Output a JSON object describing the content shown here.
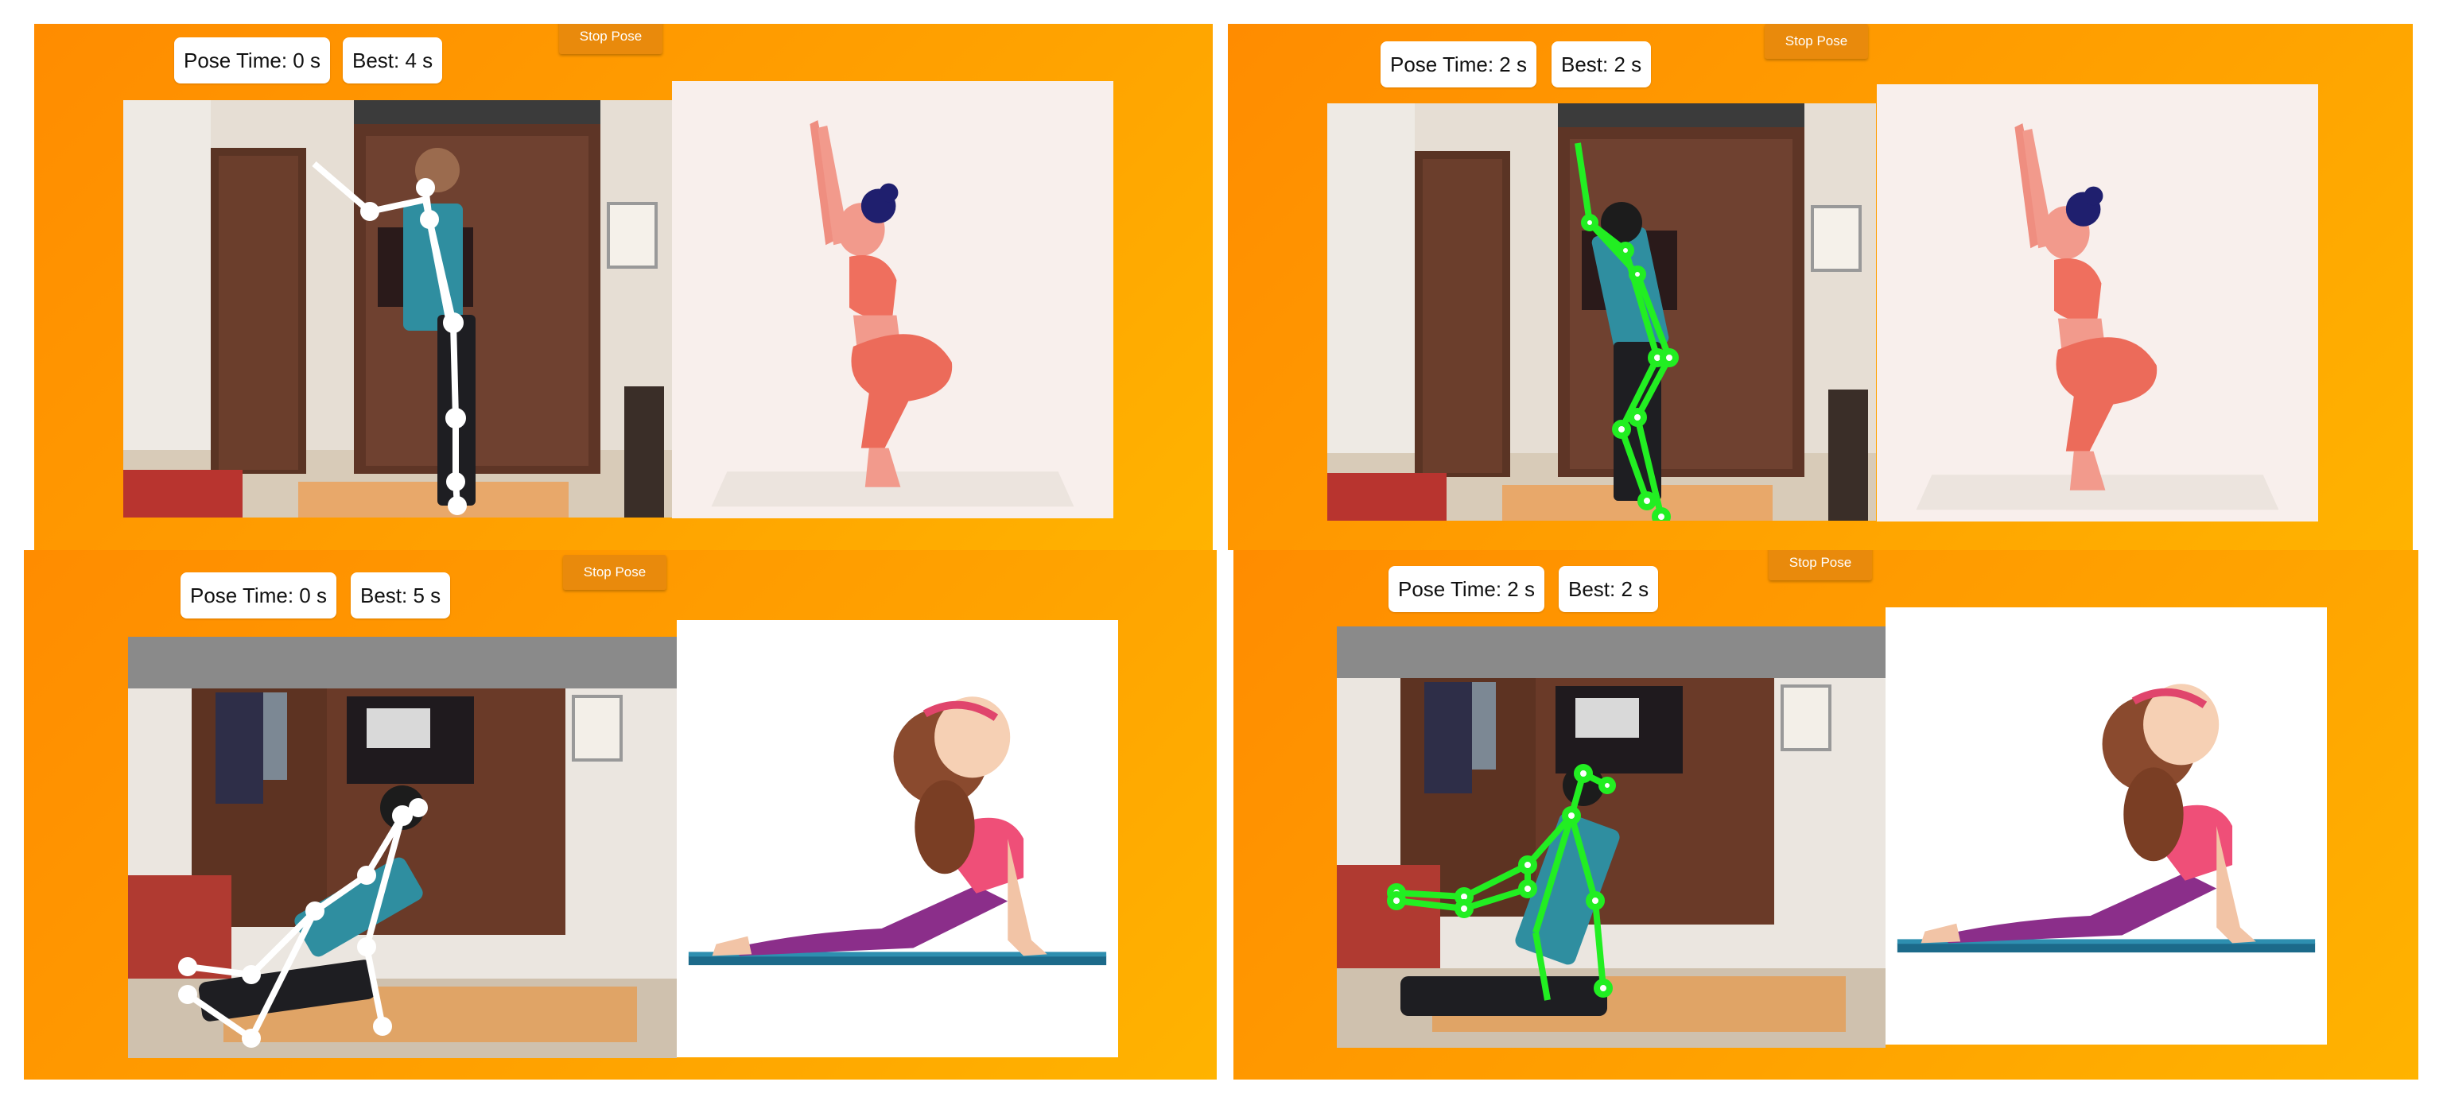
{
  "panels": [
    {
      "pose_time_label": "Pose Time: 0 s",
      "best_label": "Best: 4 s",
      "stop_button_label": "Stop Pose",
      "skeleton_state": "not-matched",
      "pose": "chair"
    },
    {
      "pose_time_label": "Pose Time: 2 s",
      "best_label": "Best: 2 s",
      "stop_button_label": "Stop Pose",
      "skeleton_state": "matched",
      "pose": "chair"
    },
    {
      "pose_time_label": "Pose Time: 0 s",
      "best_label": "Best: 5 s",
      "stop_button_label": "Stop Pose",
      "skeleton_state": "not-matched",
      "pose": "cobra"
    },
    {
      "pose_time_label": "Pose Time: 2 s",
      "best_label": "Best: 2 s",
      "stop_button_label": "Stop Pose",
      "skeleton_state": "matched",
      "pose": "cobra"
    }
  ],
  "colors": {
    "panel_orange": "#ff9500",
    "skeleton_matched": "#22ee22",
    "skeleton_not_matched": "#ffffff",
    "button_orange": "#e98a0c"
  }
}
